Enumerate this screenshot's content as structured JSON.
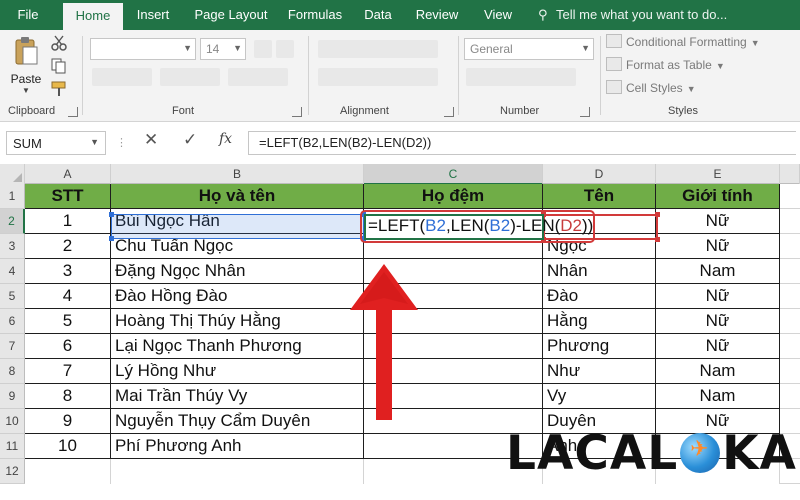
{
  "ribbon_tabs": {
    "file": "File",
    "home": "Home",
    "insert": "Insert",
    "page_layout": "Page Layout",
    "formulas": "Formulas",
    "data": "Data",
    "review": "Review",
    "view": "View",
    "tell_me": "Tell me what you want to do..."
  },
  "ribbon": {
    "paste_label": "Paste",
    "clipboard_label": "Clipboard",
    "font_label": "Font",
    "font_size": "14",
    "alignment_label": "Alignment",
    "number_format": "General",
    "number_label": "Number",
    "conditional_formatting": "Conditional Formatting",
    "format_as_table": "Format as Table",
    "cell_styles": "Cell Styles",
    "styles_label": "Styles"
  },
  "formula_bar": {
    "name_box": "SUM",
    "formula": "=LEFT(B2,LEN(B2)-LEN(D2))"
  },
  "columns": [
    "A",
    "B",
    "C",
    "D",
    "E"
  ],
  "row_numbers": [
    "1",
    "2",
    "3",
    "4",
    "5",
    "6",
    "7",
    "8",
    "9",
    "10",
    "11",
    "12"
  ],
  "table": {
    "headers": [
      "STT",
      "Họ và tên",
      "Họ đệm",
      "Tên",
      "Giới tính"
    ],
    "rows": [
      {
        "stt": "1",
        "name": "Bùi Ngọc Hân",
        "last": "",
        "gender": "Nữ"
      },
      {
        "stt": "2",
        "name": "Chu Tuấn Ngọc",
        "last": "Ngọc",
        "gender": "Nữ"
      },
      {
        "stt": "3",
        "name": "Đặng Ngọc Nhân",
        "last": "Nhân",
        "gender": "Nam"
      },
      {
        "stt": "4",
        "name": "Đào Hồng Đào",
        "last": "Đào",
        "gender": "Nữ"
      },
      {
        "stt": "5",
        "name": "Hoàng Thị Thúy Hằng",
        "last": "Hằng",
        "gender": "Nữ"
      },
      {
        "stt": "6",
        "name": "Lại Ngọc Thanh Phương",
        "last": "Phương",
        "gender": "Nữ"
      },
      {
        "stt": "7",
        "name": "Lý Hồng Như",
        "last": "Như",
        "gender": "Nam"
      },
      {
        "stt": "8",
        "name": "Mai Trần Thúy Vy",
        "last": "Vy",
        "gender": "Nam"
      },
      {
        "stt": "9",
        "name": "Nguyễn Thụy Cẩm Duyên",
        "last": "Duyên",
        "gender": "Nữ"
      },
      {
        "stt": "10",
        "name": "Phí Phương Anh",
        "last": "Anh",
        "gender": ""
      }
    ]
  },
  "editing_cell": {
    "prefix": "=LEFT(",
    "ref1": "B2",
    "sep1": ",LEN(",
    "ref2": "B2",
    "sep2": ")-LEN(",
    "ref3": "D2",
    "suffix": "))"
  },
  "watermark": {
    "part1": "LACAL",
    "part2": "KA"
  },
  "colors": {
    "excel_green": "#217346",
    "header_fill": "#70ad47",
    "arrow_red": "#e02020",
    "ref_blue": "#2f6fd6",
    "ref_red": "#c83c3c"
  }
}
